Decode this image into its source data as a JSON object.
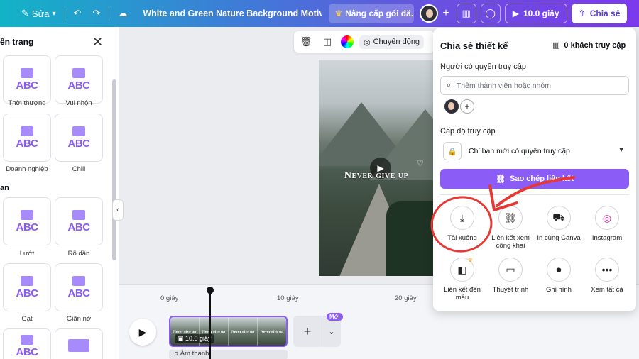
{
  "topbar": {
    "edit_label": "Sửa",
    "title": "White and Green Nature Background Motivation Ti...",
    "upgrade_label": "Nâng cấp gói đă...",
    "duration_label": "10.0 giây",
    "share_label": "Chia sẻ"
  },
  "left_panel": {
    "title": "ển trang",
    "section2": "an",
    "tiles": [
      {
        "label": "Thời thượng",
        "art": "ABC"
      },
      {
        "label": "Vui nhộn",
        "art": "ABC"
      },
      {
        "label": "Doanh nghiệp",
        "art": "ABC"
      },
      {
        "label": "Chill",
        "art": "ABC"
      },
      {
        "label": "Lướt",
        "art": "ABC"
      },
      {
        "label": "Rõ dần",
        "art": "ABC"
      },
      {
        "label": "Gạt",
        "art": "ABC"
      },
      {
        "label": "Giãn nở",
        "art": "ABC"
      },
      {
        "label": "",
        "art": "ABC"
      },
      {
        "label": "",
        "art": ""
      }
    ]
  },
  "canvas_toolbar": {
    "motion_label": "Chuyển động"
  },
  "design": {
    "text": "Never give up"
  },
  "timeline": {
    "labels": [
      "0 giây",
      "10 giây",
      "20 giây"
    ],
    "clip_duration": "10.0 giây",
    "frame_text": "Never give up",
    "audio_label": "Âm thanh",
    "new_badge": "Mới"
  },
  "share_panel": {
    "title": "Chia sẻ thiết kế",
    "visitors": "0 khách truy cập",
    "access_people_label": "Người có quyền truy cập",
    "search_placeholder": "Thêm thành viên hoặc nhóm",
    "access_level_label": "Cấp độ truy cập",
    "access_value": "Chỉ bạn mới có quyền truy cập",
    "copy_link": "Sao chép liên kết",
    "options": [
      {
        "label": "Tải xuống",
        "icon": "download-icon"
      },
      {
        "label": "Liên kết xem công khai",
        "icon": "link-icon"
      },
      {
        "label": "In cùng Canva",
        "icon": "truck-icon"
      },
      {
        "label": "Instagram",
        "icon": "instagram-icon"
      },
      {
        "label": "Liên kết đến mẫu",
        "icon": "template-icon"
      },
      {
        "label": "Thuyết trình",
        "icon": "present-icon"
      },
      {
        "label": "Ghi hình",
        "icon": "record-icon"
      },
      {
        "label": "Xem tất cả",
        "icon": "more-icon"
      }
    ]
  },
  "colors": {
    "accent": "#8b5cf6",
    "annotation": "#e53935"
  }
}
